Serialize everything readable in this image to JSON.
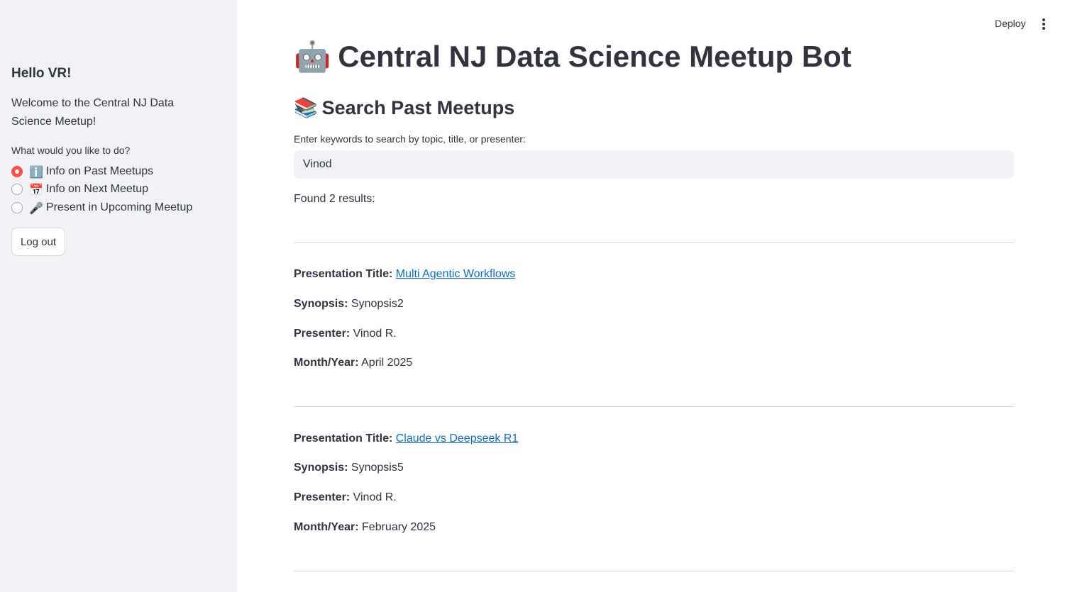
{
  "sidebar": {
    "greeting": "Hello VR!",
    "welcome": "Welcome to the Central NJ Data Science Meetup!",
    "question": "What would you like to do?",
    "options": [
      {
        "emoji": "ℹ️",
        "label": "Info on Past Meetups",
        "selected": true
      },
      {
        "emoji": "📅",
        "label": "Info on Next Meetup",
        "selected": false
      },
      {
        "emoji": "🎤",
        "label": "Present in Upcoming Meetup",
        "selected": false
      }
    ],
    "logout_label": "Log out"
  },
  "toolbar": {
    "deploy_label": "Deploy",
    "menu_icon": "kebab-menu-icon"
  },
  "main": {
    "title_emoji": "🤖",
    "title": "Central NJ Data Science Meetup Bot",
    "subtitle_emoji": "📚",
    "subtitle": "Search Past Meetups",
    "search_label": "Enter keywords to search by topic, title, or presenter:",
    "search_value": "Vinod",
    "found_text": "Found 2 results:",
    "field_labels": {
      "title": "Presentation Title:",
      "synopsis": "Synopsis:",
      "presenter": "Presenter:",
      "month_year": "Month/Year:"
    },
    "results": [
      {
        "title": "Multi Agentic Workflows",
        "synopsis": "Synopsis2",
        "presenter": "Vinod R.",
        "month_year": "April 2025"
      },
      {
        "title": "Claude vs Deepseek R1",
        "synopsis": "Synopsis5",
        "presenter": "Vinod R.",
        "month_year": "February 2025"
      }
    ]
  },
  "colors": {
    "sidebar_bg": "#f0f2f6",
    "accent": "#ff4b4b",
    "link": "#0b6bcb",
    "text": "#31333f"
  }
}
